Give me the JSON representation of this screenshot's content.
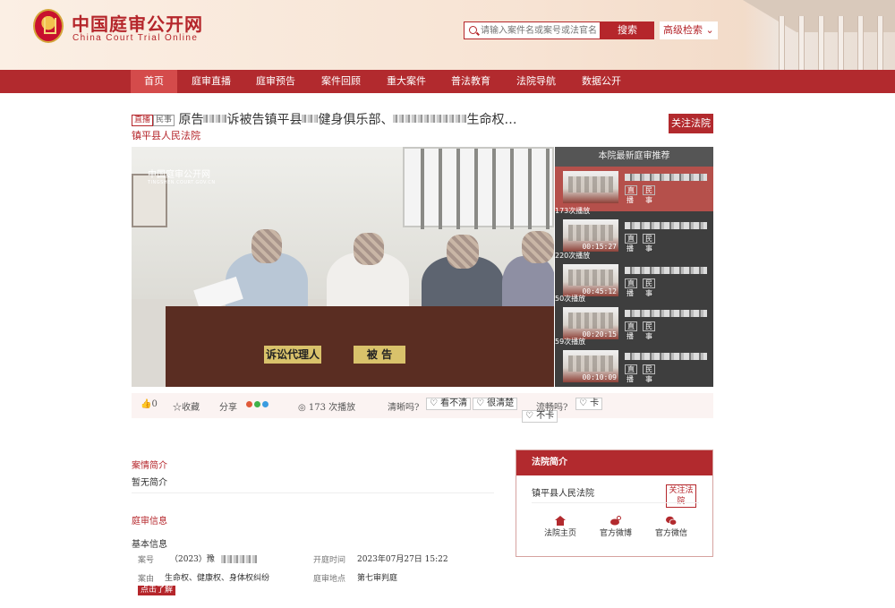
{
  "header": {
    "logo_cn": "中国庭审公开网",
    "logo_en": "China Court Trial Online",
    "search_placeholder": "请输入案件名或案号或法官名",
    "search_button": "搜索",
    "advanced_search": "高级检索 ⌄"
  },
  "nav": {
    "items": [
      "首页",
      "庭审直播",
      "庭审预告",
      "案件回顾",
      "重大案件",
      "普法教育",
      "法院导航",
      "数据公开"
    ]
  },
  "case": {
    "tag1": "直播",
    "tag2": "民事",
    "title_part1": "原告",
    "title_part2": "诉被告镇平县",
    "title_part3": "健身俱乐部、",
    "title_part4": "生命权…",
    "court": "镇平县人民法院",
    "follow": "关注法院"
  },
  "video": {
    "watermark": "中国庭审公开网",
    "watermark_url": "TINGSHEN.COURT.GOV.CN",
    "sign_agent": "诉讼代理人",
    "sign_defendant": "被 告"
  },
  "sidebar": {
    "title": "本院最新庭审推荐",
    "tag_a": "直",
    "tag_b": "民",
    "tag_a2": "播",
    "tag_b2": "事",
    "items": [
      {
        "plays": "",
        "duration": ""
      },
      {
        "plays": "173次播放",
        "duration": "00:15:27"
      },
      {
        "plays": "220次播放",
        "duration": "00:45:12"
      },
      {
        "plays": "50次播放",
        "duration": "00:20:15"
      },
      {
        "plays": "59次播放",
        "duration": "00:10:09"
      }
    ]
  },
  "controls": {
    "likes": "👍0",
    "collect": "☆收藏",
    "share": "分享",
    "plays": "◎ 173 次播放",
    "clarity_q": "清晰吗?",
    "opt_unclear": "♡ 看不清",
    "opt_clear": "♡ 很清楚",
    "opt_smooth_no": "♡ 不卡",
    "smooth_q": "流畅吗?",
    "opt_lag": "♡ 卡"
  },
  "summary": {
    "title": "案情简介",
    "text": "暂无简介"
  },
  "info": {
    "title": "庭审信息",
    "basic": "基本信息",
    "case_no_label": "案号",
    "case_no_value": "（2023）豫",
    "time_label": "开庭时间",
    "time_value": "2023年07月27日 15:22",
    "cause_label": "案由",
    "cause_value": "生命权、健康权、身体权纠纷",
    "place_label": "庭审地点",
    "place_value": "第七审判庭",
    "learn_more": "点击了解"
  },
  "court_box": {
    "title": "法院简介",
    "name": "镇平县人民法院",
    "follow": "关注法院",
    "link_home": "法院主页",
    "link_weibo": "官方微博",
    "link_wechat": "官方微信"
  },
  "colors": {
    "brand_red": "#b22a2e",
    "nav_active": "#d44b4b"
  }
}
